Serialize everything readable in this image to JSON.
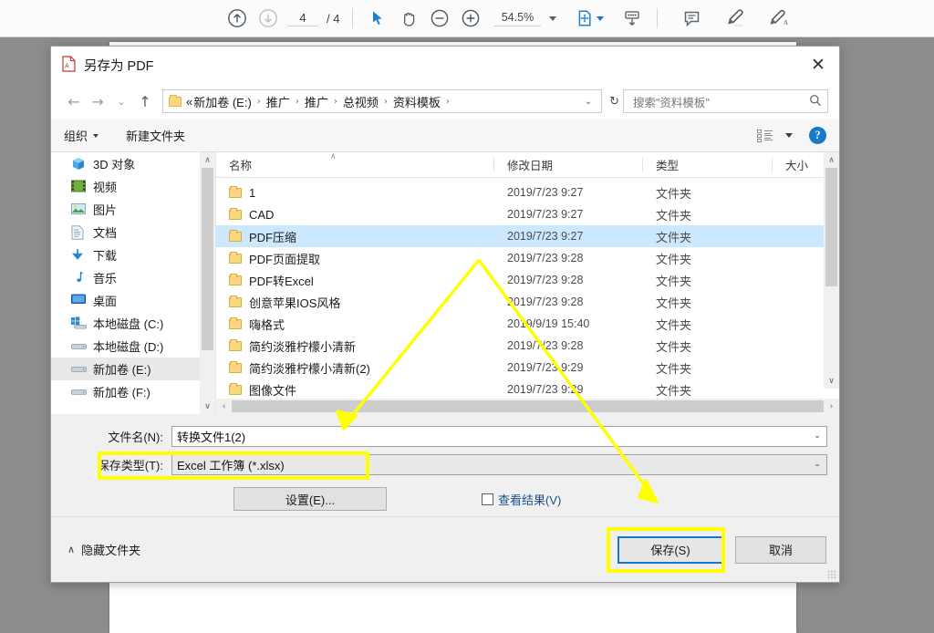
{
  "reader": {
    "page_current": "4",
    "page_total": "/ 4",
    "zoom_level": "54.5%",
    "tools": [
      {
        "name": "previous-page-icon",
        "label": "上一页"
      },
      {
        "name": "next-page-icon",
        "label": "下一页"
      },
      {
        "name": "select-tool-icon",
        "label": "选择工具"
      },
      {
        "name": "hand-tool-icon",
        "label": "手形工具"
      },
      {
        "name": "zoom-out-icon",
        "label": "缩小"
      },
      {
        "name": "zoom-in-icon",
        "label": "放大"
      },
      {
        "name": "page-fit-icon",
        "label": "页面适合"
      },
      {
        "name": "scroll-mode-icon",
        "label": "滚动模式"
      },
      {
        "name": "comment-icon",
        "label": "注释"
      },
      {
        "name": "highlight-icon",
        "label": "高亮"
      },
      {
        "name": "signature-icon",
        "label": "签名"
      }
    ]
  },
  "dialog": {
    "title": "另存为 PDF",
    "close_label": "✕",
    "nav": {
      "back_label": "←",
      "forward_label": "→",
      "recent_label": "⌄",
      "up_label": "↑",
      "breadcrumb_prefix": "«",
      "breadcrumb": [
        "新加卷 (E:)",
        "推广",
        "推广",
        "总视频",
        "资料模板"
      ],
      "breadcrumb_trailing": "›",
      "dropdown_label": "⌄",
      "refresh_label": "↻",
      "search_placeholder": "搜索\"资料模板\""
    },
    "command_bar": {
      "organize_label": "组织",
      "new_folder_label": "新建文件夹",
      "view_mode_label": "更改您的视图",
      "help_label": "?"
    },
    "nav_pane": {
      "items": [
        {
          "label": "3D 对象",
          "icon": "cube-icon",
          "selected": false
        },
        {
          "label": "视频",
          "icon": "video-icon",
          "selected": false
        },
        {
          "label": "图片",
          "icon": "picture-icon",
          "selected": false
        },
        {
          "label": "文档",
          "icon": "document-icon",
          "selected": false
        },
        {
          "label": "下载",
          "icon": "download-icon",
          "selected": false
        },
        {
          "label": "音乐",
          "icon": "music-icon",
          "selected": false
        },
        {
          "label": "桌面",
          "icon": "desktop-icon",
          "selected": false
        },
        {
          "label": "本地磁盘 (C:)",
          "icon": "windows-drive-icon",
          "selected": false
        },
        {
          "label": "本地磁盘 (D:)",
          "icon": "drive-icon",
          "selected": false
        },
        {
          "label": "新加卷 (E:)",
          "icon": "drive-icon",
          "selected": true
        },
        {
          "label": "新加卷 (F:)",
          "icon": "drive-icon",
          "selected": false
        }
      ]
    },
    "file_list": {
      "columns": [
        "名称",
        "修改日期",
        "类型",
        "大小"
      ],
      "rows": [
        {
          "name": "1",
          "date": "2019/7/23 9:27",
          "type": "文件夹",
          "size": "",
          "selected": false
        },
        {
          "name": "CAD",
          "date": "2019/7/23 9:27",
          "type": "文件夹",
          "size": "",
          "selected": false
        },
        {
          "name": "PDF压缩",
          "date": "2019/7/23 9:27",
          "type": "文件夹",
          "size": "",
          "selected": true
        },
        {
          "name": "PDF页面提取",
          "date": "2019/7/23 9:28",
          "type": "文件夹",
          "size": "",
          "selected": false
        },
        {
          "name": "PDF转Excel",
          "date": "2019/7/23 9:28",
          "type": "文件夹",
          "size": "",
          "selected": false
        },
        {
          "name": "创意苹果IOS风格",
          "date": "2019/7/23 9:28",
          "type": "文件夹",
          "size": "",
          "selected": false
        },
        {
          "name": "嗨格式",
          "date": "2019/9/19 15:40",
          "type": "文件夹",
          "size": "",
          "selected": false
        },
        {
          "name": "简约淡雅柠檬小清新",
          "date": "2019/7/23 9:28",
          "type": "文件夹",
          "size": "",
          "selected": false
        },
        {
          "name": "简约淡雅柠檬小清新(2)",
          "date": "2019/7/23 9:29",
          "type": "文件夹",
          "size": "",
          "selected": false
        },
        {
          "name": "图像文件",
          "date": "2019/7/23 9:29",
          "type": "文件夹",
          "size": "",
          "selected": false
        }
      ]
    },
    "form": {
      "filename_label": "文件名(N):",
      "filename_value": "转换文件1(2)",
      "savetype_label": "保存类型(T):",
      "savetype_value": "Excel 工作簿 (*.xlsx)",
      "settings_label": "设置(E)...",
      "view_result_label": "查看结果(V)",
      "view_result_checked": false
    },
    "footer": {
      "hide_folders_label": "隐藏文件夹",
      "hide_folders_caret": "∧",
      "save_label": "保存(S)",
      "cancel_label": "取消"
    }
  },
  "annotations": {
    "highlight_color": "#ffff00",
    "highlighted_elements": [
      "savetype-field",
      "save-button"
    ],
    "arrow_count": 2
  }
}
